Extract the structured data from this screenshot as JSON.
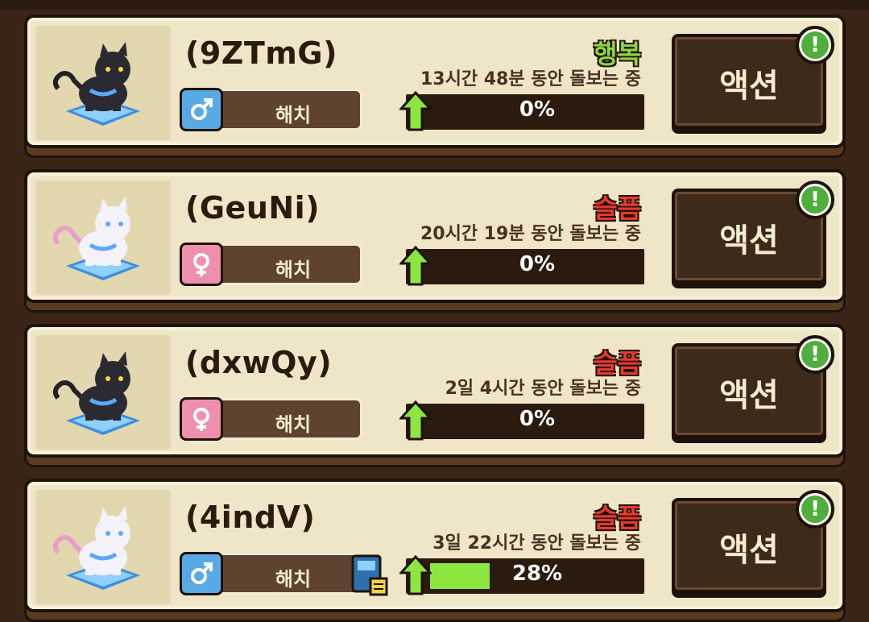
{
  "pets": [
    {
      "name": "(9ZTmG)",
      "gender": "male",
      "gender_symbol": "♂",
      "stage": "해치",
      "mood": "행복",
      "mood_color": "#8ed63a",
      "care_time": "13시간 48분 동안 돌보는 중",
      "progress_percent": 0,
      "progress_text": "0%",
      "color": "black",
      "has_diary": false,
      "action_label": "액션",
      "alert": "!"
    },
    {
      "name": "(GeuNi)",
      "gender": "female",
      "gender_symbol": "♀",
      "stage": "해치",
      "mood": "슬픔",
      "mood_color": "#e8382c",
      "care_time": "20시간 19분 동안 돌보는 중",
      "progress_percent": 0,
      "progress_text": "0%",
      "color": "white",
      "has_diary": false,
      "action_label": "액션",
      "alert": "!"
    },
    {
      "name": "(dxwQy)",
      "gender": "female",
      "gender_symbol": "♀",
      "stage": "해치",
      "mood": "슬픔",
      "mood_color": "#e8382c",
      "care_time": "2일 4시간 동안 돌보는 중",
      "progress_percent": 0,
      "progress_text": "0%",
      "color": "black",
      "has_diary": false,
      "action_label": "액션",
      "alert": "!"
    },
    {
      "name": "(4indV)",
      "gender": "male",
      "gender_symbol": "♂",
      "stage": "해치",
      "mood": "슬픔",
      "mood_color": "#e8382c",
      "care_time": "3일 22시간 동안 돌보는 중",
      "progress_percent": 28,
      "progress_text": "28%",
      "color": "white",
      "has_diary": true,
      "action_label": "액션",
      "alert": "!"
    }
  ]
}
